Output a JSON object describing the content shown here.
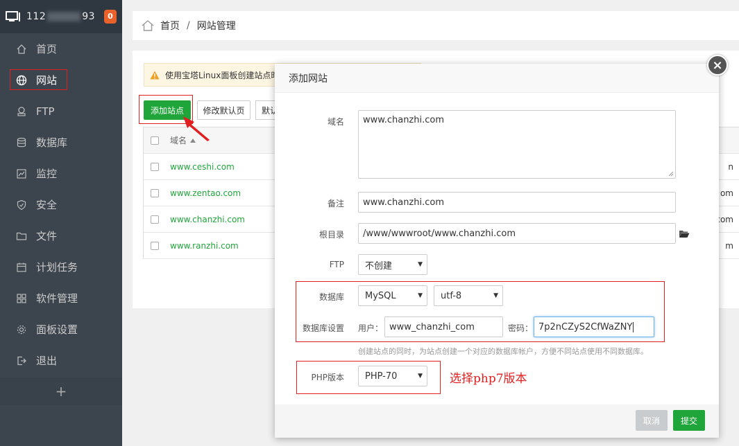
{
  "sidebar": {
    "ip_prefix": "112",
    "ip_suffix": "93",
    "badge": "0",
    "items": [
      {
        "label": "首页"
      },
      {
        "label": "网站"
      },
      {
        "label": "FTP"
      },
      {
        "label": "数据库"
      },
      {
        "label": "监控"
      },
      {
        "label": "安全"
      },
      {
        "label": "文件"
      },
      {
        "label": "计划任务"
      },
      {
        "label": "软件管理"
      },
      {
        "label": "面板设置"
      },
      {
        "label": "退出"
      }
    ],
    "add_label": "+"
  },
  "breadcrumb": {
    "home": "首页",
    "sep": "/",
    "current": "网站管理"
  },
  "panel": {
    "warning": "使用宝塔Linux面板创建站点时",
    "add_site_label": "添加站点",
    "modify_default_label": "修改默认页",
    "default_label": "默认",
    "table": {
      "header_domain": "域名",
      "rows": [
        {
          "domain": "www.ceshi.com",
          "tail": "n"
        },
        {
          "domain": "www.zentao.com",
          "tail": "om"
        },
        {
          "domain": "www.chanzhi.com",
          "tail": "com"
        },
        {
          "domain": "www.ranzhi.com",
          "tail": "m"
        }
      ]
    }
  },
  "modal": {
    "title": "添加网站",
    "close": "×",
    "domain_label": "域名",
    "domain_value": "www.chanzhi.com",
    "remark_label": "备注",
    "remark_value": "www.chanzhi.com",
    "root_label": "根目录",
    "root_value": "/www/wwwroot/www.chanzhi.com",
    "ftp_label": "FTP",
    "ftp_value": "不创建",
    "db_label": "数据库",
    "db_type": "MySQL",
    "db_charset": "utf-8",
    "db_settings_label": "数据库设置",
    "user_label": "用户：",
    "user_value": "www_chanzhi_com",
    "password_label": "密码：",
    "password_value": "7p2nCZyS2CfWaZNY",
    "db_hint": "创建站点的同时，为站点创建一个对应的数据库帐户，方便不同站点使用不同数据库。",
    "php_label": "PHP版本",
    "php_value": "PHP-70",
    "php_note": "选择php7版本",
    "cancel_label": "取消",
    "submit_label": "提交"
  }
}
